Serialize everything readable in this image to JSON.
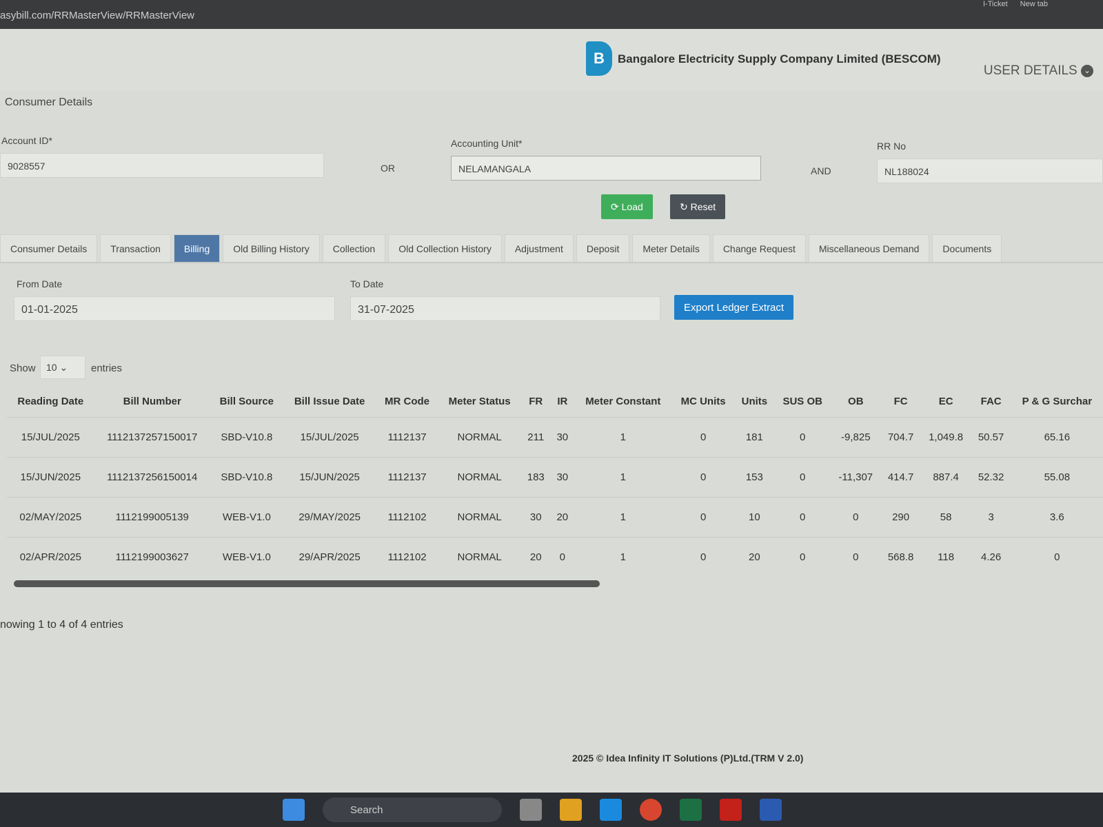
{
  "browser": {
    "url": "asybill.com/RRMasterView/RRMasterView",
    "tabs": [
      "I-Ticket",
      "New tab"
    ]
  },
  "header": {
    "company": "Bangalore Electricity Supply Company Limited (BESCOM)",
    "user_details": "USER DETAILS",
    "logo_text": "BESCOM"
  },
  "consumer": {
    "section": "Consumer Details",
    "account_label": "Account ID*",
    "account_value": "9028557",
    "or": "OR",
    "unit_label": "Accounting Unit*",
    "unit_value": "NELAMANGALA",
    "and": "AND",
    "rr_label": "RR No",
    "rr_value": "NL188024",
    "load": "Load",
    "reset": "Reset"
  },
  "tabs": [
    "Consumer Details",
    "Transaction",
    "Billing",
    "Old Billing History",
    "Collection",
    "Old Collection History",
    "Adjustment",
    "Deposit",
    "Meter Details",
    "Change Request",
    "Miscellaneous Demand",
    "Documents"
  ],
  "billing": {
    "from_label": "From Date",
    "from_value": "01-01-2025",
    "to_label": "To Date",
    "to_value": "31-07-2025",
    "export": "Export Ledger Extract",
    "show": "Show",
    "entries_value": "10",
    "entries": "entries",
    "info": "nowing 1 to 4 of 4 entries"
  },
  "table": {
    "headers": [
      "Reading Date",
      "Bill Number",
      "Bill Source",
      "Bill Issue Date",
      "MR Code",
      "Meter Status",
      "FR",
      "IR",
      "Meter Constant",
      "MC Units",
      "Units",
      "SUS OB",
      "OB",
      "FC",
      "EC",
      "FAC",
      "P & G Surchar"
    ],
    "rows": [
      [
        "15/JUL/2025",
        "1112137257150017",
        "SBD-V10.8",
        "15/JUL/2025",
        "1112137",
        "NORMAL",
        "211",
        "30",
        "1",
        "0",
        "181",
        "0",
        "-9,825",
        "704.7",
        "1,049.8",
        "50.57",
        "65.16"
      ],
      [
        "15/JUN/2025",
        "1112137256150014",
        "SBD-V10.8",
        "15/JUN/2025",
        "1112137",
        "NORMAL",
        "183",
        "30",
        "1",
        "0",
        "153",
        "0",
        "-11,307",
        "414.7",
        "887.4",
        "52.32",
        "55.08"
      ],
      [
        "02/MAY/2025",
        "1112199005139",
        "WEB-V1.0",
        "29/MAY/2025",
        "1112102",
        "NORMAL",
        "30",
        "20",
        "1",
        "0",
        "10",
        "0",
        "0",
        "290",
        "58",
        "3",
        "3.6"
      ],
      [
        "02/APR/2025",
        "1112199003627",
        "WEB-V1.0",
        "29/APR/2025",
        "1112102",
        "NORMAL",
        "20",
        "0",
        "1",
        "0",
        "20",
        "0",
        "0",
        "568.8",
        "118",
        "4.26",
        "0"
      ]
    ]
  },
  "footer": "2025 © Idea Infinity IT Solutions (P)Ltd.(TRM V 2.0)",
  "taskbar": {
    "search": "Search"
  }
}
